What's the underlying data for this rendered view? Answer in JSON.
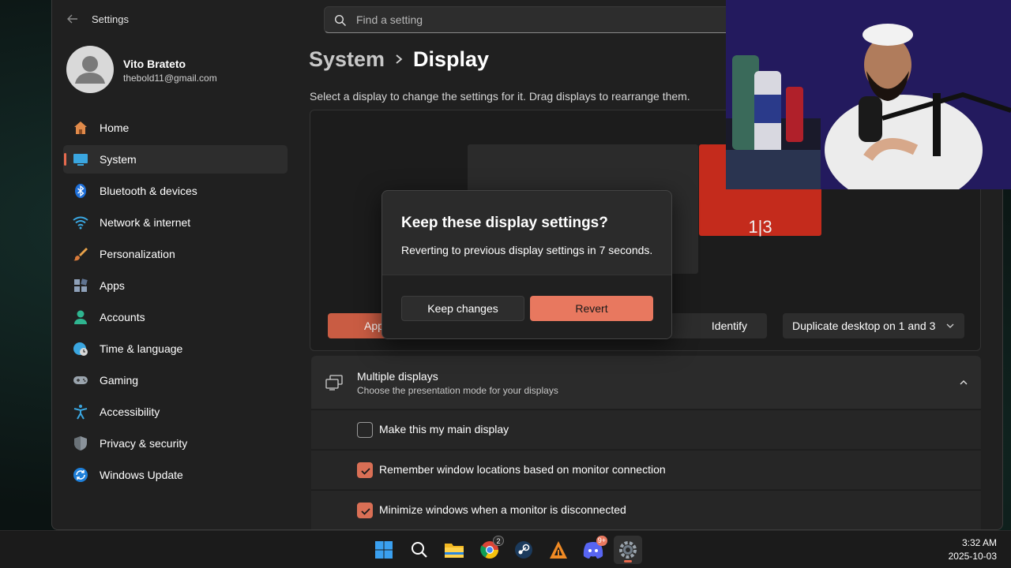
{
  "app": {
    "title": "Settings"
  },
  "search": {
    "placeholder": "Find a setting"
  },
  "user": {
    "name": "Vito Brateto",
    "email": "thebold11@gmail.com"
  },
  "sidebar": {
    "items": [
      {
        "label": "Home",
        "icon": "home-icon",
        "selected": false
      },
      {
        "label": "System",
        "icon": "system-icon",
        "selected": true
      },
      {
        "label": "Bluetooth & devices",
        "icon": "bluetooth-icon",
        "selected": false
      },
      {
        "label": "Network & internet",
        "icon": "wifi-icon",
        "selected": false
      },
      {
        "label": "Personalization",
        "icon": "brush-icon",
        "selected": false
      },
      {
        "label": "Apps",
        "icon": "apps-icon",
        "selected": false
      },
      {
        "label": "Accounts",
        "icon": "person-icon",
        "selected": false
      },
      {
        "label": "Time & language",
        "icon": "globe-clock-icon",
        "selected": false
      },
      {
        "label": "Gaming",
        "icon": "gamepad-icon",
        "selected": false
      },
      {
        "label": "Accessibility",
        "icon": "accessibility-icon",
        "selected": false
      },
      {
        "label": "Privacy & security",
        "icon": "shield-icon",
        "selected": false
      },
      {
        "label": "Windows Update",
        "icon": "update-icon",
        "selected": false
      }
    ]
  },
  "breadcrumb": {
    "root": "System",
    "page": "Display"
  },
  "main": {
    "hint": "Select a display to change the settings for it. Drag displays to rearrange them.",
    "monitor_label": "1|3",
    "apply_label": "App",
    "identify_label": "Identify",
    "display_mode": "Duplicate desktop on 1 and 3"
  },
  "multiple_displays": {
    "title": "Multiple displays",
    "subtitle": "Choose the presentation mode for your displays",
    "options": [
      {
        "label": "Make this my main display",
        "checked": false
      },
      {
        "label": "Remember window locations based on monitor connection",
        "checked": true
      },
      {
        "label": "Minimize windows when a monitor is disconnected",
        "checked": true
      }
    ]
  },
  "dialog": {
    "title": "Keep these display settings?",
    "message": "Reverting to previous display settings in  7 seconds.",
    "keep_label": "Keep changes",
    "revert_label": "Revert"
  },
  "taskbar": {
    "apps": [
      "start-icon",
      "search-icon",
      "file-explorer-icon",
      "chrome-icon",
      "steam-icon",
      "foobar-icon",
      "discord-icon",
      "settings-icon"
    ],
    "chrome_badge": "2",
    "discord_badge": "9+",
    "time": "3:32 AM",
    "date": "2025-10-03"
  },
  "colors": {
    "accent": "#e8785f",
    "window_bg": "#202020",
    "selected_display": "#c42b1c"
  }
}
